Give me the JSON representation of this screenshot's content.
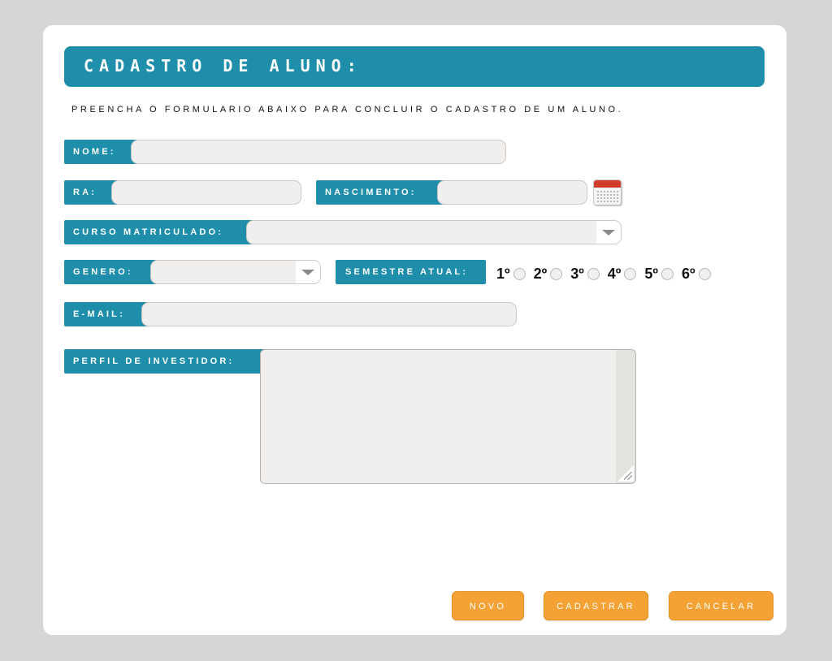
{
  "form": {
    "title": "CADASTRO DE ALUNO:",
    "intro": "PREENCHA O FORMULARIO ABAIXO PARA CONCLUIR O CADASTRO DE UM ALUNO.",
    "nome": {
      "label": "NOME:",
      "value": ""
    },
    "ra": {
      "label": "RA:",
      "value": ""
    },
    "nascimento": {
      "label": "NASCIMENTO:",
      "value": ""
    },
    "curso": {
      "label": "CURSO MATRICULADO:",
      "selected": ""
    },
    "genero": {
      "label": "GENERO:",
      "selected": ""
    },
    "semestre": {
      "label": "SEMESTRE ATUAL:",
      "options": [
        "1º",
        "2º",
        "3º",
        "4º",
        "5º",
        "6º"
      ]
    },
    "email": {
      "label": "E-MAIL:",
      "value": ""
    },
    "perfil": {
      "label": "PERFIL DE INVESTIDOR:",
      "value": ""
    }
  },
  "buttons": {
    "novo": "NOVO",
    "cadastrar": "CADASTRAR",
    "cancelar": "CANCELAR"
  },
  "icons": {
    "calendar": "calendar-icon",
    "dropdown": "chevron-down-icon"
  },
  "colors": {
    "background": "#d6d6d6",
    "card": "#ffffff",
    "accent": "#1e8eab",
    "field": "#f1efed",
    "button": "#f4a236"
  }
}
